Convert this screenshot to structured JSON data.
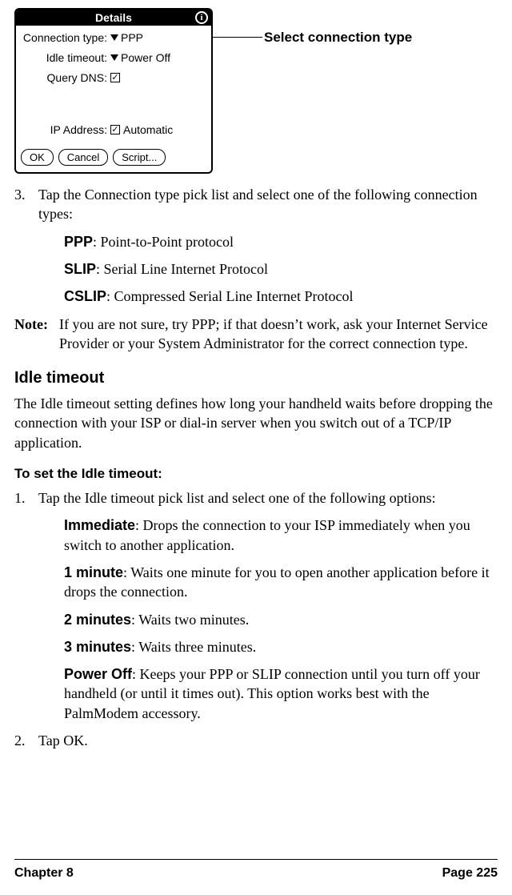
{
  "device": {
    "title": "Details",
    "info_glyph": "i",
    "rows": {
      "connection_label": "Connection type:",
      "connection_value": "PPP",
      "idle_label": "Idle timeout:",
      "idle_value": "Power Off",
      "query_label": "Query DNS:",
      "query_check": "✓",
      "ip_label": "IP Address:",
      "ip_check": "✓",
      "ip_value": "Automatic"
    },
    "buttons": {
      "ok": "OK",
      "cancel": "Cancel",
      "script": "Script..."
    }
  },
  "callout": "Select connection type",
  "step3": {
    "num": "3.",
    "text": "Tap the Connection type pick list and select one of the following connection types:"
  },
  "defs1": [
    {
      "term": "PPP",
      "desc": ": Point-to-Point protocol"
    },
    {
      "term": "SLIP",
      "desc": ": Serial Line Internet Protocol"
    },
    {
      "term": "CSLIP",
      "desc": ": Compressed Serial Line Internet Protocol"
    }
  ],
  "note": {
    "label": "Note:",
    "text": "If you are not sure, try PPP; if that doesn’t work, ask your Internet Service Provider or your System Administrator for the correct connection type."
  },
  "idle": {
    "heading": "Idle timeout",
    "para": "The Idle timeout setting defines how long your handheld waits before dropping the connection with your ISP or dial-in server when you switch out of a TCP/IP application."
  },
  "sub": {
    "heading": "To set the Idle timeout:",
    "step1_num": "1.",
    "step1_text": "Tap the Idle timeout pick list and select one of the following options:",
    "step2_num": "2.",
    "step2_text": "Tap OK."
  },
  "defs2": [
    {
      "term": "Immediate",
      "desc": ": Drops the connection to your ISP immediately when you switch to another application."
    },
    {
      "term": "1 minute",
      "desc": ": Waits one minute for you to open another application before it drops the connection."
    },
    {
      "term": "2 minutes",
      "desc": ": Waits two minutes."
    },
    {
      "term": "3 minutes",
      "desc": ": Waits three minutes."
    },
    {
      "term": "Power Off",
      "desc": ": Keeps your PPP or SLIP connection until you turn off your handheld (or until it times out). This option works best with the PalmModem accessory."
    }
  ],
  "footer": {
    "left": "Chapter 8",
    "right": "Page 225"
  }
}
